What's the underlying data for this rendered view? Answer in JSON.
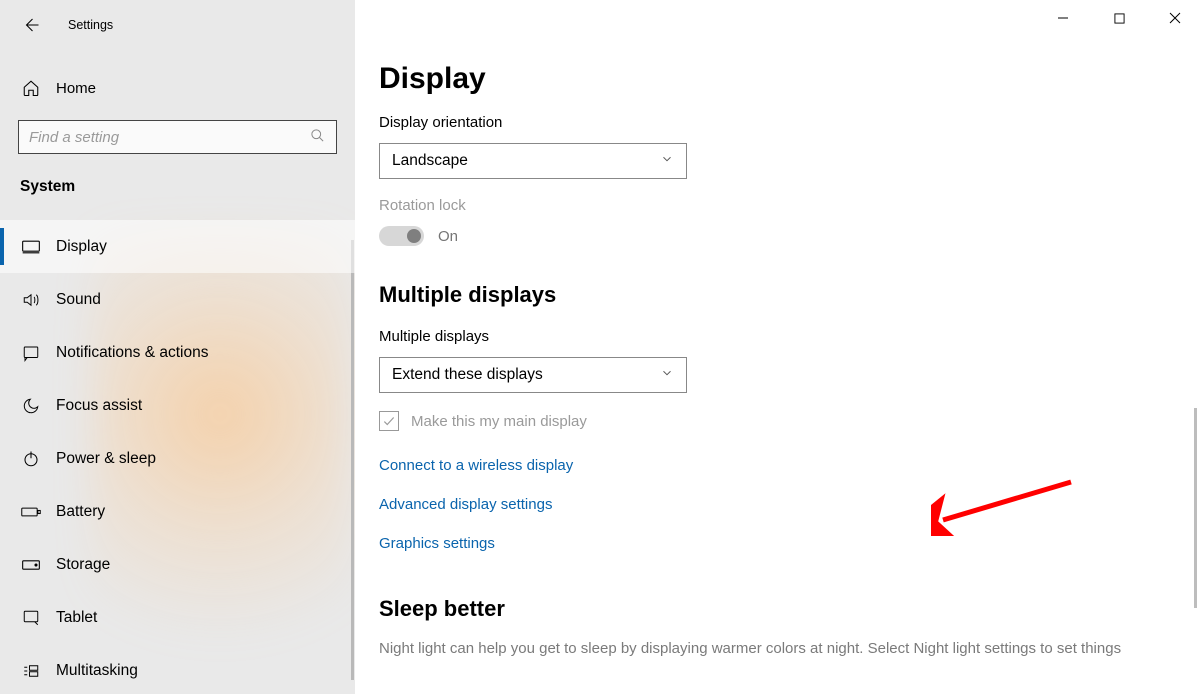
{
  "window": {
    "title": "Settings"
  },
  "sidebar": {
    "home_label": "Home",
    "search_placeholder": "Find a setting",
    "section_label": "System",
    "items": [
      {
        "icon": "display-icon",
        "label": "Display",
        "active": true
      },
      {
        "icon": "sound-icon",
        "label": "Sound"
      },
      {
        "icon": "notifications-icon",
        "label": "Notifications & actions"
      },
      {
        "icon": "focus-assist-icon",
        "label": "Focus assist"
      },
      {
        "icon": "power-sleep-icon",
        "label": "Power & sleep"
      },
      {
        "icon": "battery-icon",
        "label": "Battery"
      },
      {
        "icon": "storage-icon",
        "label": "Storage"
      },
      {
        "icon": "tablet-icon",
        "label": "Tablet"
      },
      {
        "icon": "multitasking-icon",
        "label": "Multitasking"
      }
    ]
  },
  "main": {
    "page_title": "Display",
    "orientation_label": "Display orientation",
    "orientation_value": "Landscape",
    "rotation_lock_label": "Rotation lock",
    "rotation_lock_value": "On",
    "multiple_displays_heading": "Multiple displays",
    "multiple_displays_label": "Multiple displays",
    "multiple_displays_value": "Extend these displays",
    "main_display_checkbox_label": "Make this my main display",
    "links": {
      "connect_wireless": "Connect to a wireless display",
      "advanced_display": "Advanced display settings",
      "graphics": "Graphics settings"
    },
    "sleep_heading": "Sleep better",
    "sleep_body": "Night light can help you get to sleep by displaying warmer colors at night. Select Night light settings to set things"
  }
}
